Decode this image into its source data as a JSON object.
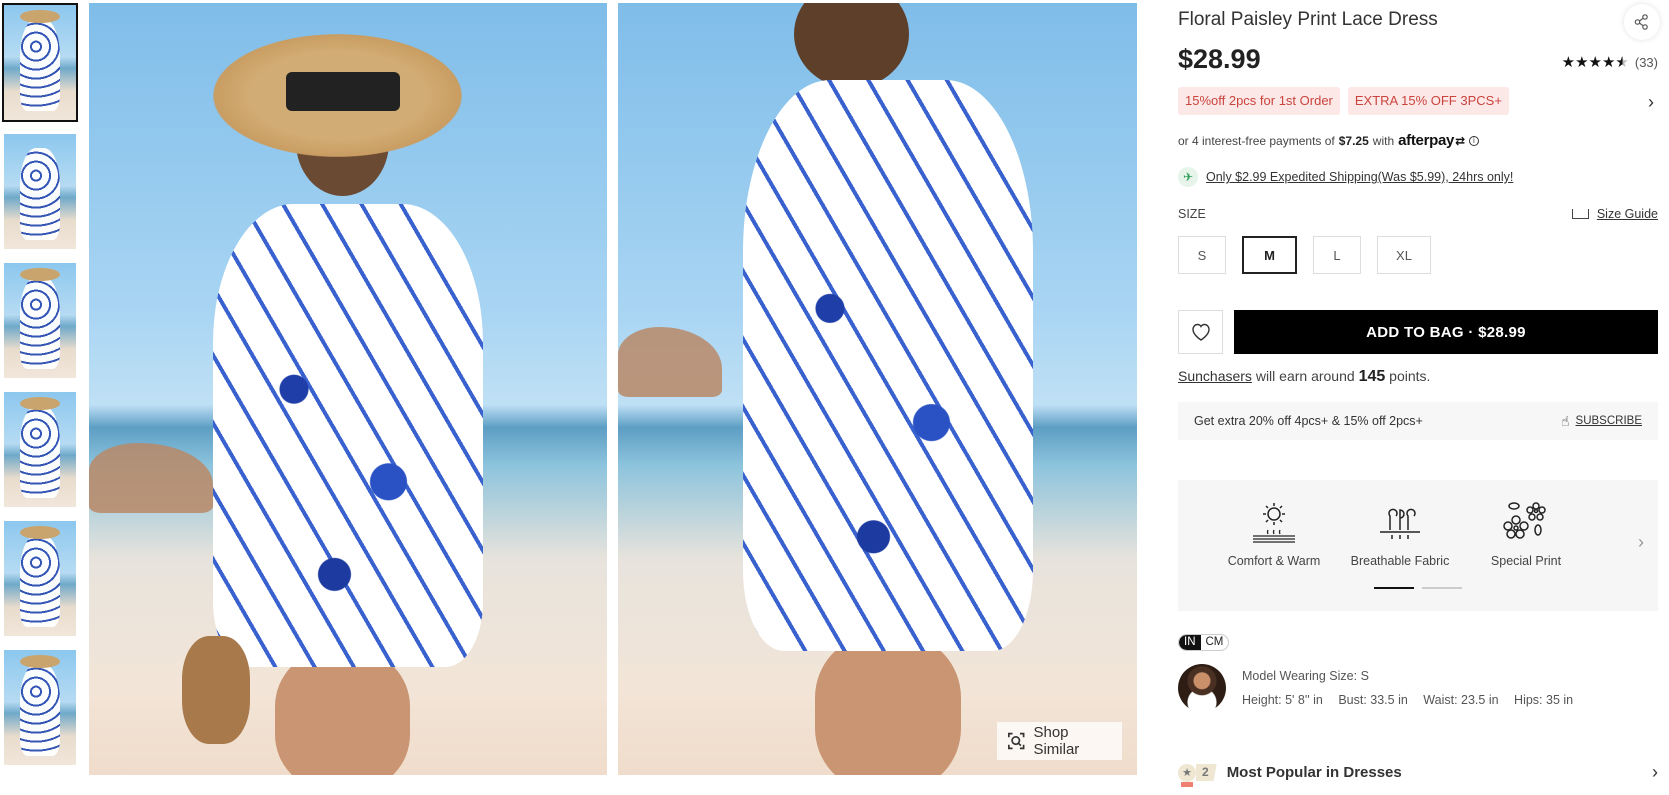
{
  "gallery": {
    "thumbnails": [
      {
        "label": "Front view with hat",
        "active": true
      },
      {
        "label": "Back view",
        "active": false
      },
      {
        "label": "Front view walking",
        "active": false
      },
      {
        "label": "Front view with bag",
        "active": false
      },
      {
        "label": "Front view close",
        "active": false
      },
      {
        "label": "Side view",
        "active": false
      }
    ],
    "shop_similar_label": "Shop Similar"
  },
  "product": {
    "title": "Floral Paisley Print Lace Dress",
    "price": "$28.99",
    "rating": {
      "stars": 4.5,
      "count": "(33)"
    },
    "promos": [
      "15%off 2pcs for 1st Order",
      "EXTRA 15% OFF 3PCS+"
    ],
    "afterpay": {
      "prefix": "or 4 interest-free payments of",
      "amount": "$7.25",
      "with": "with",
      "brand": "afterpay"
    },
    "shipping_text": "Only $2.99 Expedited Shipping(Was $5.99), 24hrs only!",
    "size": {
      "label": "SIZE",
      "guide_label": "Size Guide",
      "options": [
        "S",
        "M",
        "L",
        "XL"
      ],
      "selected": "M"
    },
    "add_to_bag_label": "ADD TO BAG · $28.99",
    "points": {
      "program": "Sunchasers",
      "middle": "will earn around",
      "amount": "145",
      "suffix": "points."
    },
    "subscribe": {
      "text": "Get extra 20% off 4pcs+ & 15% off 2pcs+",
      "link": "SUBSCRIBE"
    },
    "features": [
      {
        "icon": "sun-warm-icon",
        "label": "Comfort & Warm"
      },
      {
        "icon": "breathable-icon",
        "label": "Breathable Fabric"
      },
      {
        "icon": "flower-print-icon",
        "label": "Special Print"
      }
    ],
    "features_page": {
      "current": 1,
      "total": 2
    },
    "units": {
      "options": [
        "IN",
        "CM"
      ],
      "selected": "IN"
    },
    "model": {
      "wearing": "Model Wearing Size: S",
      "height": "Height: 5' 8'' in",
      "bust": "Bust: 33.5 in",
      "waist": "Waist: 23.5 in",
      "hips": "Hips: 35 in"
    },
    "popular": {
      "rank": "2",
      "label": "Most Popular in Dresses"
    }
  }
}
